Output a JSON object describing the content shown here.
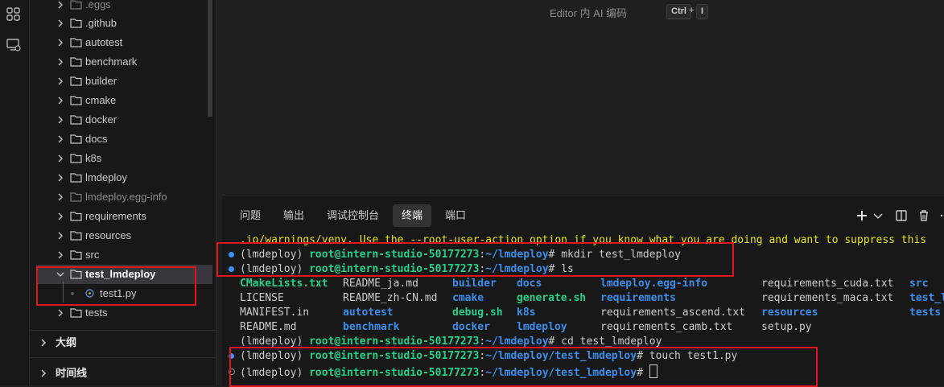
{
  "explorer": {
    "items": [
      {
        "label": ".eggs",
        "dim": true
      },
      {
        "label": ".github"
      },
      {
        "label": "autotest"
      },
      {
        "label": "benchmark"
      },
      {
        "label": "builder"
      },
      {
        "label": "cmake"
      },
      {
        "label": "docker"
      },
      {
        "label": "docs"
      },
      {
        "label": "k8s"
      },
      {
        "label": "lmdeploy"
      },
      {
        "label": "lmdeploy.egg-info",
        "dim": true
      },
      {
        "label": "requirements"
      },
      {
        "label": "resources"
      },
      {
        "label": "src"
      },
      {
        "label": "test_lmdeploy",
        "expanded": true,
        "selected": true
      },
      {
        "label": "test1.py",
        "file": true
      },
      {
        "label": "tests"
      }
    ],
    "sections": [
      "大纲",
      "时间线"
    ]
  },
  "editor": {
    "hint": "Editor 内 AI 编码",
    "key1": "Ctrl",
    "key_plus": "+",
    "key2": "I"
  },
  "panel": {
    "tabs": [
      "问题",
      "输出",
      "调试控制台",
      "终端",
      "端口"
    ],
    "active_tab": "终端"
  },
  "terminal": {
    "warning_line": ".io/warnings/venv. Use the --root-user-action option if you know what you are doing and want to suppress this",
    "env": "(lmdeploy)",
    "user_host": "root@intern-studio-50177273",
    "lines": [
      {
        "path": "~/lmdeploy",
        "cmd": "mkdir test_lmdeploy"
      },
      {
        "path": "~/lmdeploy",
        "cmd": "ls"
      },
      {
        "path": "~/lmdeploy",
        "cmd": "cd test_lmdeploy"
      },
      {
        "path": "~/lmdeploy/test_lmdeploy",
        "cmd": "touch test1.py"
      },
      {
        "path": "~/lmdeploy/test_lmdeploy",
        "cmd": ""
      }
    ],
    "ls_rows": [
      [
        "CMakeLists.txt",
        "README_ja.md",
        "builder",
        "docs",
        "lmdeploy.egg-info",
        "requirements_cuda.txt",
        "src"
      ],
      [
        "LICENSE",
        "README_zh-CN.md",
        "cmake",
        "generate.sh",
        "requirements",
        "requirements_maca.txt",
        "test_l"
      ],
      [
        "MANIFEST.in",
        "autotest",
        "debug.sh",
        "k8s",
        "requirements_ascend.txt",
        "resources",
        "tests"
      ],
      [
        "README.md",
        "benchmark",
        "docker",
        "lmdeploy",
        "requirements_camb.txt",
        "setup.py",
        ""
      ]
    ],
    "ls_colors": [
      [
        "green",
        "white",
        "blue",
        "blue",
        "blue",
        "white",
        "blue"
      ],
      [
        "white",
        "white",
        "blue",
        "green",
        "blue",
        "white",
        "blue"
      ],
      [
        "white",
        "blue",
        "green",
        "blue",
        "white",
        "blue",
        "blue"
      ],
      [
        "white",
        "blue",
        "blue",
        "blue",
        "white",
        "white",
        "white"
      ]
    ]
  }
}
